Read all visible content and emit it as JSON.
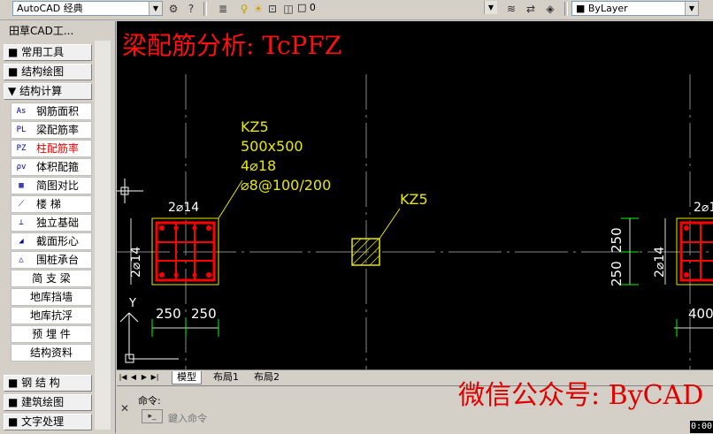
{
  "toolbar": {
    "workspace": "AutoCAD 经典",
    "layer_name": "0",
    "linetype": "ByLayer"
  },
  "panel": {
    "title": "田草CAD工...",
    "categories": [
      "常用工具",
      "结构绘图",
      "结构计算",
      "钢  结  构",
      "建筑绘图",
      "文字处理"
    ],
    "category_markers": [
      "■",
      "■",
      "▼",
      "■",
      "■",
      "■"
    ],
    "items": [
      {
        "icon": "As",
        "label": "钢筋面积"
      },
      {
        "icon": "PL",
        "label": "梁配筋率"
      },
      {
        "icon": "PZ",
        "label": "柱配筋率"
      },
      {
        "icon": "ρv",
        "label": "体积配箍"
      },
      {
        "icon": "▦",
        "label": "简图对比"
      },
      {
        "icon": "⟋",
        "label": "楼    梯"
      },
      {
        "icon": "⊥",
        "label": "独立基础"
      },
      {
        "icon": "◢",
        "label": "截面形心"
      },
      {
        "icon": "△",
        "label": "围桩承台"
      },
      {
        "icon": "",
        "label": "简 支 梁"
      },
      {
        "icon": "",
        "label": "地库挡墙"
      },
      {
        "icon": "",
        "label": "地库抗浮"
      },
      {
        "icon": "",
        "label": "预 埋 件"
      },
      {
        "icon": "",
        "label": "结构资料"
      }
    ]
  },
  "drawing": {
    "title_overlay": "梁配筋分析: TcPFZ",
    "column1_label": [
      "KZ5",
      "500x500",
      "4⌀18",
      "⌀8@100/200"
    ],
    "column2_label": "KZ5",
    "rebar_top": "2⌀14",
    "rebar_side": "2⌀14",
    "rebar_top_right": "2⌀1",
    "rebar_side_right": "2⌀14",
    "dim_left": "250",
    "dim_right": "250",
    "dim_vert_top": "250",
    "dim_vert_bottom": "250",
    "dim_400": "400",
    "ucs_y": "Y"
  },
  "tabs": [
    "模型",
    "布局1",
    "布局2"
  ],
  "command": {
    "prompt": "命令:",
    "placeholder": "鍵入命令"
  },
  "watermark": "微信公众号: ByCAD",
  "timestamp": "0:00"
}
